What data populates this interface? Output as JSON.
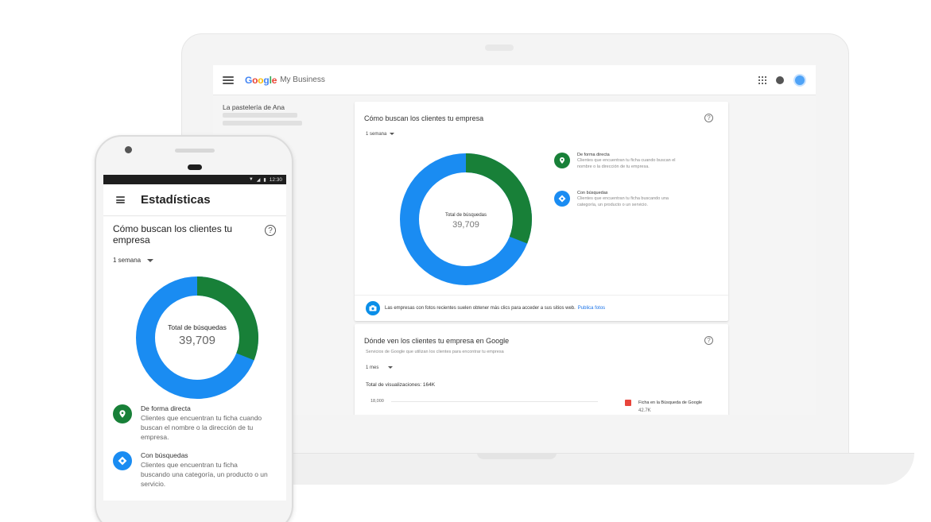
{
  "laptop": {
    "logo_letters": [
      "G",
      "o",
      "o",
      "g",
      "l",
      "e"
    ],
    "product": "My Business",
    "business_name": "La pastelería de Ana",
    "card1": {
      "title": "Cómo buscan los clientes tu empresa",
      "help": "?",
      "period": "1 semana",
      "center_label": "Total de búsquedas",
      "center_value": "39,709",
      "legend": [
        {
          "title": "De forma directa",
          "desc_lines": [
            "Clientes que encuentran tu ficha cuando buscan el",
            "nombre o la dirección de tu empresa."
          ],
          "color": "#188038",
          "icon": "map-pin-icon"
        },
        {
          "title": "Con búsquedas",
          "desc_lines": [
            "Clientes que encuentran tu ficha buscando una",
            "categoría, un producto o un servicio."
          ],
          "color": "#1a8cf2",
          "icon": "discovery-icon"
        }
      ],
      "photo_text": "Las empresas con fotos recientes suelen obtener más clics para acceder a sus sitios web.",
      "photo_link": "Publica fotos"
    },
    "card2": {
      "title": "Dónde ven los clientes tu empresa en Google",
      "help": "?",
      "subtitle": "Servicios de Google que utilizan los clientes para encontrar tu empresa",
      "period": "1 mes",
      "total_views": "Total de visualizaciones: 164K",
      "y_tick": "18,000",
      "legend_label": "Ficha en la Búsqueda de Google",
      "legend_value": "42.7K"
    }
  },
  "phone": {
    "status_time": "12:30",
    "app_title": "Estadísticas",
    "card_title": "Cómo buscan los clientes tu empresa",
    "help": "?",
    "period": "1 semana",
    "center_label": "Total de búsquedas",
    "center_value": "39,709",
    "legend": [
      {
        "title": "De forma directa",
        "desc_lines": [
          "Clientes que encuentran tu ficha cuando",
          "buscan el nombre o la dirección de tu",
          "empresa."
        ],
        "color": "#188038",
        "icon": "map-pin-icon"
      },
      {
        "title": "Con búsquedas",
        "desc_lines": [
          "Clientes que encuentran tu ficha",
          "buscando una categoría, un producto o un",
          "servicio."
        ],
        "color": "#1a8cf2",
        "icon": "discovery-icon"
      }
    ]
  },
  "chart_data": {
    "type": "pie",
    "categories": [
      "De forma directa",
      "Con búsquedas"
    ],
    "values": [
      0.31,
      0.69
    ],
    "colors": [
      "#188038",
      "#1a8cf2"
    ],
    "center_label": "Total de búsquedas",
    "center_value": "39,709"
  }
}
